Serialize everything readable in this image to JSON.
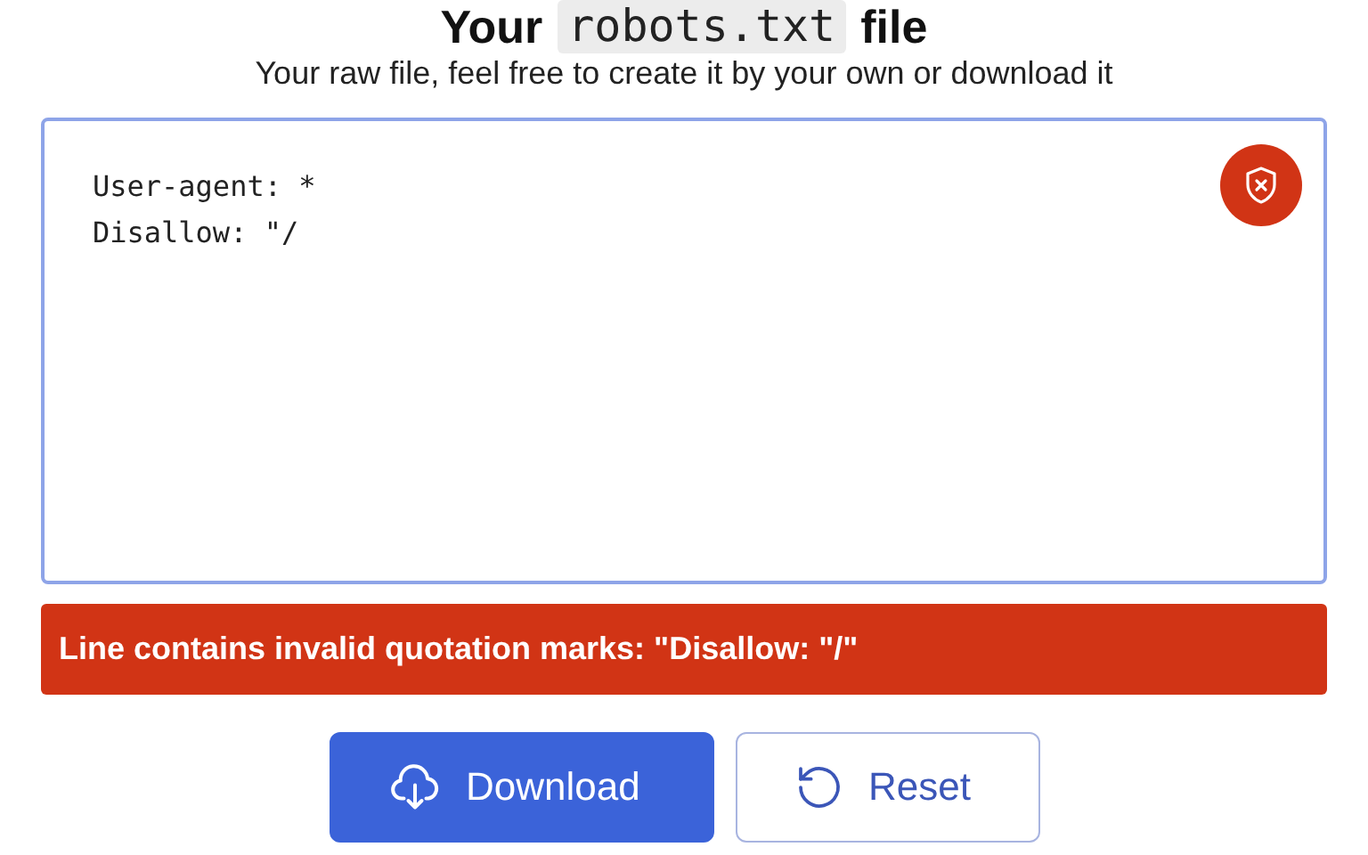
{
  "header": {
    "title_before": "Your",
    "title_code": "robots.txt",
    "title_after": "file",
    "subtitle": "Your raw file, feel free to create it by your own or download it"
  },
  "editor": {
    "lines": [
      "User-agent: *",
      "Disallow: \"/"
    ],
    "invalid": true
  },
  "error": {
    "message": "Line contains invalid quotation marks: \"Disallow: \"/\""
  },
  "buttons": [
    {
      "label": "Download",
      "kind": "primary"
    },
    {
      "label": "Reset",
      "kind": "secondary"
    }
  ]
}
